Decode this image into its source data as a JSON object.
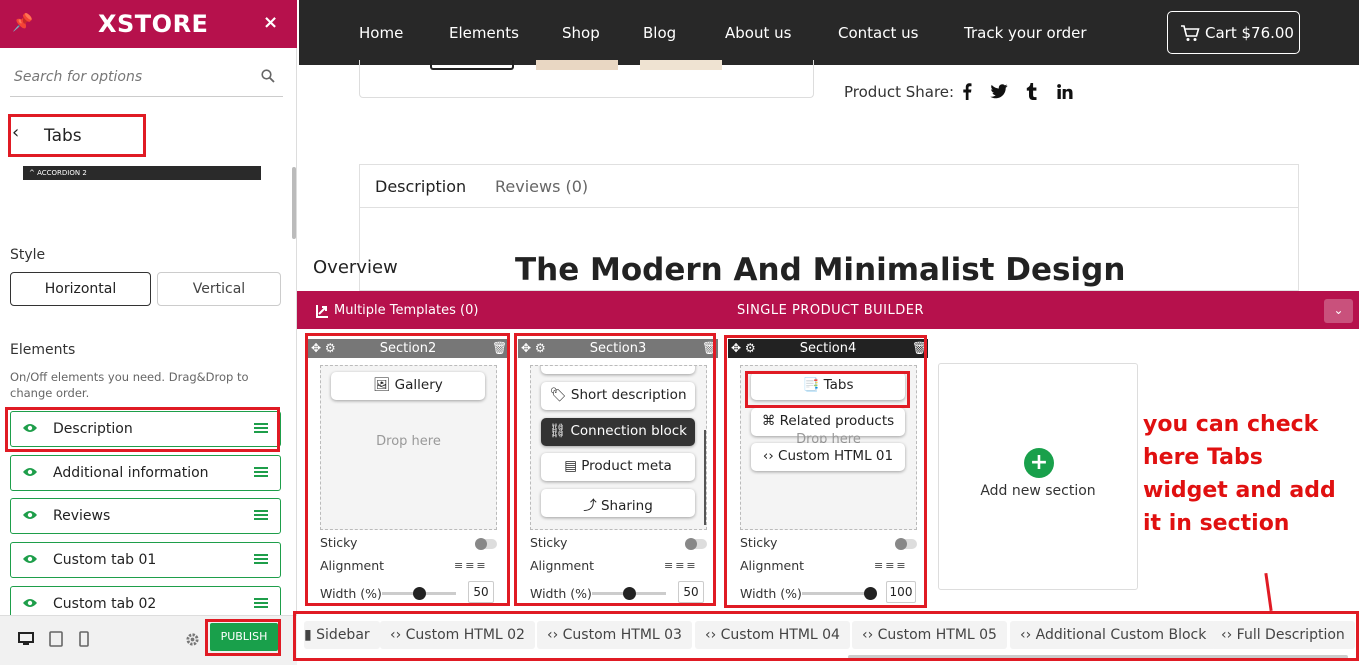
{
  "panel": {
    "logo": "XSTORE",
    "close": "×",
    "search_placeholder": "Search for options",
    "back_title": "Tabs",
    "accordion_label": "ACCORDION 2",
    "style_title": "Style",
    "style_options": [
      "Horizontal",
      "Vertical"
    ],
    "elements_title": "Elements",
    "elements_desc": "On/Off elements you need. Drag&Drop to change order.",
    "elements": [
      "Description",
      "Additional information",
      "Reviews",
      "Custom tab 01",
      "Custom tab 02"
    ],
    "publish": "PUBLISH"
  },
  "nav": {
    "items": [
      "Home",
      "Elements",
      "Shop",
      "Blog",
      "About us",
      "Contact us",
      "Track your order"
    ],
    "cart": "Cart $76.00"
  },
  "product": {
    "share_label": "Product Share:",
    "share_icons": [
      "facebook-icon",
      "twitter-icon",
      "tumblr-icon",
      "linkedin-icon"
    ],
    "tabs": [
      "Description",
      "Reviews (0)"
    ],
    "overview": "Overview",
    "headline": "The Modern And Minimalist Design"
  },
  "builder": {
    "multiple_templates": "Multiple Templates (0)",
    "title": "SINGLE PRODUCT BUILDER",
    "sections": [
      {
        "name": "Section2",
        "widgets": [
          "Gallery"
        ],
        "drop_text": "Drop here",
        "width": "50"
      },
      {
        "name": "Section3",
        "widgets": [
          "Short description",
          "Connection block",
          "Product meta",
          "Sharing"
        ],
        "width": "50"
      },
      {
        "name": "Section4",
        "widgets": [
          "Tabs",
          "Related products",
          "Custom HTML 01"
        ],
        "drop_text": "Drop here",
        "width": "100"
      }
    ],
    "labels": {
      "sticky": "Sticky",
      "alignment": "Alignment",
      "width": "Width (%)"
    },
    "add_section": "Add new section",
    "templates": [
      "Sidebar",
      "Custom HTML 02",
      "Custom HTML 03",
      "Custom HTML 04",
      "Custom HTML 05",
      "Additional Custom Block",
      "Full Description"
    ]
  },
  "annotation": "you can check here Tabs widget and add it in section",
  "colors": {
    "brand": "#b6114c",
    "nav_bg": "#282828",
    "publish": "#19a04b",
    "highlight": "#e01b24",
    "annotation": "#e01010"
  }
}
